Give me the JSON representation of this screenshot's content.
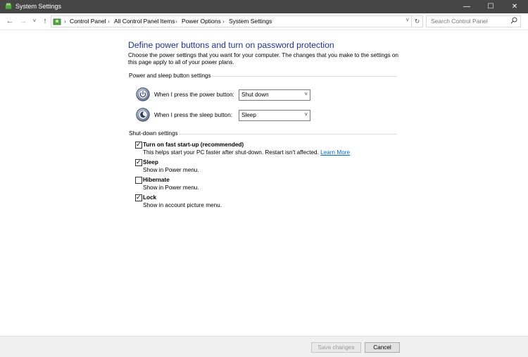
{
  "window": {
    "title": "System Settings",
    "minimize_icon": "minimize-icon",
    "maximize_icon": "maximize-icon",
    "close_icon": "close-icon"
  },
  "nav": {
    "breadcrumbs": [
      "Control Panel",
      "All Control Panel Items",
      "Power Options",
      "System Settings"
    ],
    "search_placeholder": "Search Control Panel"
  },
  "main": {
    "title": "Define power buttons and turn on password protection",
    "description": "Choose the power settings that you want for your computer. The changes that you make to the settings on this page apply to all of your power plans.",
    "power_section_label": "Power and sleep button settings",
    "power_button_label": "When I press the power button:",
    "power_button_value": "Shut down",
    "sleep_button_label": "When I press the sleep button:",
    "sleep_button_value": "Sleep",
    "shutdown_section_label": "Shut-down settings",
    "options": [
      {
        "label": "Turn on fast start-up (recommended)",
        "description": "This helps start your PC faster after shut-down. Restart isn't affected.",
        "link": "Learn More",
        "checked": true
      },
      {
        "label": "Sleep",
        "description": "Show in Power menu.",
        "checked": true
      },
      {
        "label": "Hibernate",
        "description": "Show in Power menu.",
        "checked": false
      },
      {
        "label": "Lock",
        "description": "Show in account picture menu.",
        "checked": true
      }
    ]
  },
  "footer": {
    "save_label": "Save changes",
    "cancel_label": "Cancel"
  },
  "colors": {
    "title_bar": "#464646",
    "heading": "#1e3287",
    "link": "#0066cc"
  }
}
